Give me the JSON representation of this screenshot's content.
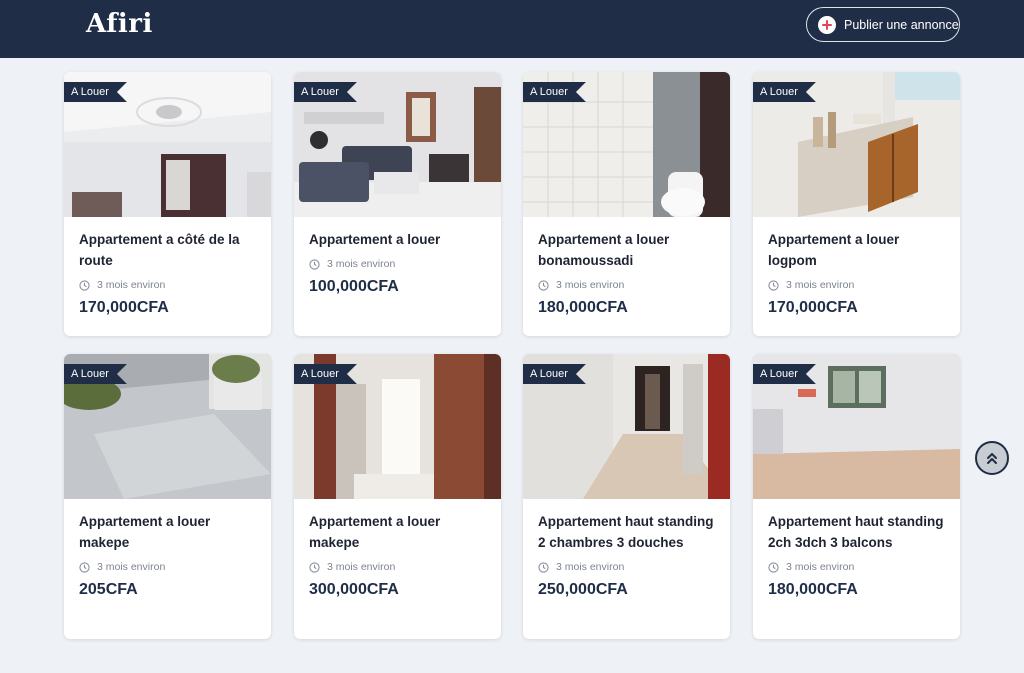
{
  "header": {
    "logo": "Afiri",
    "publish_label": "Publier une annonce"
  },
  "listings": [
    {
      "badge": "A Louer",
      "title": "Appartement a côté de la route",
      "time": "3 mois environ",
      "price": "170,000CFA"
    },
    {
      "badge": "A Louer",
      "title": "Appartement a louer",
      "time": "3 mois environ",
      "price": "100,000CFA"
    },
    {
      "badge": "A Louer",
      "title": "Appartement a louer bonamoussadi",
      "time": "3 mois environ",
      "price": "180,000CFA"
    },
    {
      "badge": "A Louer",
      "title": "Appartement a louer logpom",
      "time": "3 mois environ",
      "price": "170,000CFA"
    },
    {
      "badge": "A Louer",
      "title": "Appartement a louer makepe",
      "time": "3 mois environ",
      "price": "205CFA"
    },
    {
      "badge": "A Louer",
      "title": "Appartement a louer makepe",
      "time": "3 mois environ",
      "price": "300,000CFA"
    },
    {
      "badge": "A Louer",
      "title": "Appartement haut standing 2 chambres 3 douches",
      "time": "3 mois environ",
      "price": "250,000CFA"
    },
    {
      "badge": "A Louer",
      "title": "Appartement haut standing 2ch 3dch 3 balcons",
      "time": "3 mois environ",
      "price": "180,000CFA"
    }
  ],
  "colors": {
    "navbar": "#1f2d47",
    "background": "#eef1f5",
    "accent_plus": "#e0455a"
  },
  "icons": {
    "publish": "plus-circle-icon",
    "time": "clock-icon",
    "scroll": "double-chevron-up-icon"
  }
}
